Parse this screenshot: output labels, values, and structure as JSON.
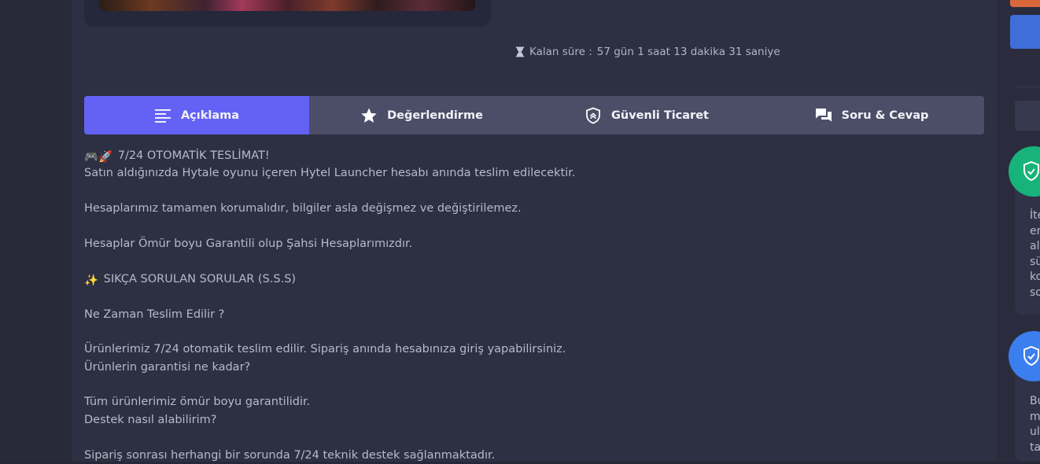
{
  "timer": {
    "label": "Kalan süre :",
    "value": "57 gün 1 saat 13 dakika 31 saniye"
  },
  "tabs": [
    {
      "label": "Açıklama",
      "icon": "lines-icon",
      "active": true
    },
    {
      "label": "Değerlendirme",
      "icon": "star-icon",
      "active": false
    },
    {
      "label": "Güvenli Ticaret",
      "icon": "shield-icon",
      "active": false
    },
    {
      "label": "Soru & Cevap",
      "icon": "chat-icon",
      "active": false
    }
  ],
  "description": {
    "heading_emoji": "🎮🚀",
    "heading": "7/24 OTOMATİK TESLİMAT!",
    "line1": "Satın aldığınızda Hytale oyunu içeren Hytel Launcher hesabı anında teslim edilecektir.",
    "line2": "Hesaplarımız tamamen korumalıdır, bilgiler asla değişmez ve değiştirilemez.",
    "line3": "Hesaplar Ömür boyu Garantili olup Şahsi Hesaplarımızdır.",
    "faq_emoji": "✨",
    "faq_heading": "SIKÇA SORULAN SORULAR (S.S.S)",
    "q1": "Ne Zaman Teslim Edilir ?",
    "a1": "Ürünlerimiz 7/24 otomatik teslim edilir. Sipariş anında hesabınıza giriş yapabilirsiniz.",
    "q2": "Ürünlerin garantisi ne kadar?",
    "a2": "Tüm ürünlerimiz ömür boyu garantilidir.",
    "q3": "Destek nasıl alabilirim?",
    "a3": "Sipariş sonrası herhangi bir sorunda 7/24 teknik destek sağlanmaktadır."
  },
  "right_panel": {
    "card1_lines": [
      "İte",
      "er",
      "al",
      "sü",
      "ko",
      "so"
    ],
    "card2_lines": [
      "Bu",
      "m",
      "ul",
      "ta"
    ],
    "colors": {
      "green": "#17b37a",
      "blue": "#3b7ef0",
      "orange": "#d9673c"
    }
  }
}
